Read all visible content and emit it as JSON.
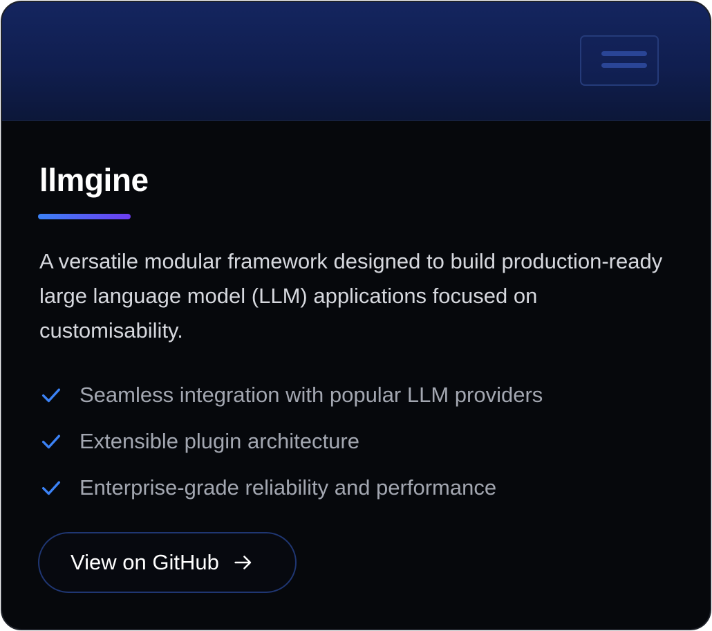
{
  "card": {
    "title": "llmgine",
    "description": "A versatile modular framework designed to build production-ready large language model (LLM) applications focused on customisability.",
    "features": [
      "Seamless integration with popular LLM providers",
      "Extensible plugin architecture",
      "Enterprise-grade reliability and performance"
    ],
    "cta_label": "View on GitHub"
  },
  "icons": {
    "menu": "hamburger-menu-icon",
    "feature_bullet": "checkmark-icon",
    "cta": "arrow-right-icon"
  },
  "colors": {
    "header_gradient_top": "#14255f",
    "header_gradient_bottom": "#0c1739",
    "card_background": "#06080c",
    "accent_start": "#3b82f6",
    "accent_end": "#6d3df2",
    "check": "#3b82f6",
    "button_border": "#1f3672"
  }
}
